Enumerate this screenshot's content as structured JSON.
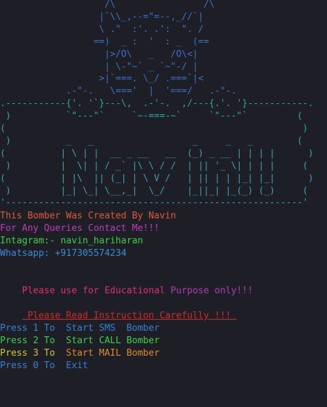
{
  "banner": {
    "ascii_lines": [
      {
        "text": "                   /\\                /\\",
        "color": "#3a6fd0"
      },
      {
        "text": "                  |`\\\\_,--=\"=--,_//`|",
        "color": "#3a6fd0"
      },
      {
        "text": "                  \\ .\"  :'. .':  \". /",
        "color": "#3a6fd0"
      },
      {
        "text": "                 ==)  _ :  '  : _  (==",
        "color": "#3a6fd0"
      },
      {
        "text": "                   |>/O\\   _   /O\\<|",
        "color": "#3a6fd0"
      },
      {
        "text": "                   | \\-\"~` _ `~\"-/ |",
        "color": "#3a6fd0"
      },
      {
        "text": "                  >|`===. \\_/ .===`|<",
        "color": "#3a6fd0"
      },
      {
        "text": "            .-\"-.   \\==='  |  '===/   .-\"-.",
        "color": "#3a6fd0"
      },
      {
        "text": ".-----------{'. '`}---\\,  .-'-.  ,/---{.'. '}-----------.",
        "color": "#2aa8a0"
      },
      {
        "text": " )          `\"---\"`     `~-===-~`     `\"---\"`         (",
        "color": "#2aa8a0"
      },
      {
        "text": "(                                                      )",
        "color": "#2aa8a0"
      },
      {
        "text": " )          _   _                  _     _   _        (",
        "color": "#3aa0b0"
      },
      {
        "text": "(          | \\ | |  __ _ __   __  (_) _ __ | | | |      )",
        "color": "#3aa0b0"
      },
      {
        "text": " )         |  \\| | / _` |\\ \\ / /  | || '_ \\| | | |     (",
        "color": "#3aa0b0"
      },
      {
        "text": "(          | |\\  || (_| | \\ V /   | || | | |_| |_|      )",
        "color": "#3aa0b0"
      },
      {
        "text": " )         |_| \\_| \\__,_|  \\_/    |_||_| |_(_) (_)     (",
        "color": "#3aa0b0"
      },
      {
        "text": "'------------------------------------------------------'",
        "color": "#2aa8a0"
      }
    ]
  },
  "info": {
    "creator": "This Bomber Was Created By Navin",
    "queries": "For Any Queries Contact Me!!!",
    "instagram": "Intagram:- navin_hariharan",
    "whatsapp": "Whatsapp: +917305574234",
    "purpose_prefix": "Please use for ",
    "purpose_mid": "Educational ",
    "purpose_suffix": "Purpose only!!!",
    "instruction": " Please Read Instruction Carefully !!! "
  },
  "menu": [
    {
      "press": "Press 1 To",
      "action": "Start SMS  Bomber",
      "press_color": "#3a7fd8",
      "action_color": "#3a7fd8"
    },
    {
      "press": "Press 2 To",
      "action": "Start CALL Bomber",
      "press_color": "#3fd04a",
      "action_color": "#3fd04a"
    },
    {
      "press": "Press 3 To",
      "action": "Start MAIL Bomber",
      "press_color": "#d0c83a",
      "action_color": "#e0882a"
    },
    {
      "press": "Press 0 To",
      "action": "Exit",
      "press_color": "#3a7fd8",
      "action_color": "#3a7fd8"
    }
  ],
  "colors": {
    "background": "#1e1f26",
    "creator": "#e05a3a",
    "queries": "#c03ac0",
    "instagram": "#3fd04a",
    "whatsapp": "#3a8ad8",
    "purpose_a": "#e0306a",
    "purpose_b": "#b03ab8",
    "instruction": "#d02a2a"
  }
}
